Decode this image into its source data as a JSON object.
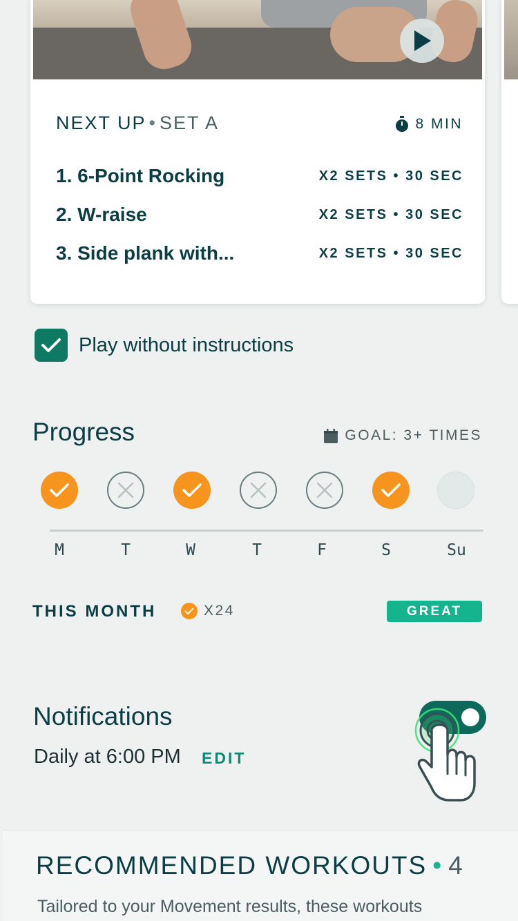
{
  "next_up": {
    "label": "NEXT UP",
    "separator": "•",
    "set_label": "SET A",
    "duration": "8 MIN",
    "duration_icon": "stopwatch-icon",
    "play_icon": "play-icon",
    "exercises": [
      {
        "name": "1. 6-Point Rocking",
        "meta": "X2 SETS • 30 SEC"
      },
      {
        "name": "2. W-raise",
        "meta": "X2 SETS • 30 SEC"
      },
      {
        "name": "3. Side plank with...",
        "meta": "X2 SETS • 30 SEC"
      }
    ]
  },
  "play_without_instructions": {
    "label": "Play without instructions",
    "checked": true
  },
  "progress": {
    "title": "Progress",
    "goal": "GOAL: 3+ TIMES",
    "goal_icon": "calendar-icon",
    "days": [
      {
        "label": "M",
        "status": "done"
      },
      {
        "label": "T",
        "status": "missed"
      },
      {
        "label": "W",
        "status": "done"
      },
      {
        "label": "T",
        "status": "missed"
      },
      {
        "label": "F",
        "status": "missed"
      },
      {
        "label": "S",
        "status": "done"
      },
      {
        "label": "Su",
        "status": "future"
      }
    ],
    "month_label": "THIS MONTH",
    "month_count": "X24",
    "badge": "GREAT"
  },
  "notifications": {
    "title": "Notifications",
    "time": "Daily at 6:00 PM",
    "edit": "EDIT",
    "enabled": true
  },
  "recommended": {
    "title": "RECOMMENDED WORKOUTS",
    "separator": "•",
    "count": "4",
    "description": "Tailored to your Movement results, these workouts"
  },
  "colors": {
    "primary": "#0b3d45",
    "accent_green": "#14b48e",
    "checkbox_green": "#0e7a63",
    "orange": "#f7941d",
    "background": "#eef1ef"
  }
}
